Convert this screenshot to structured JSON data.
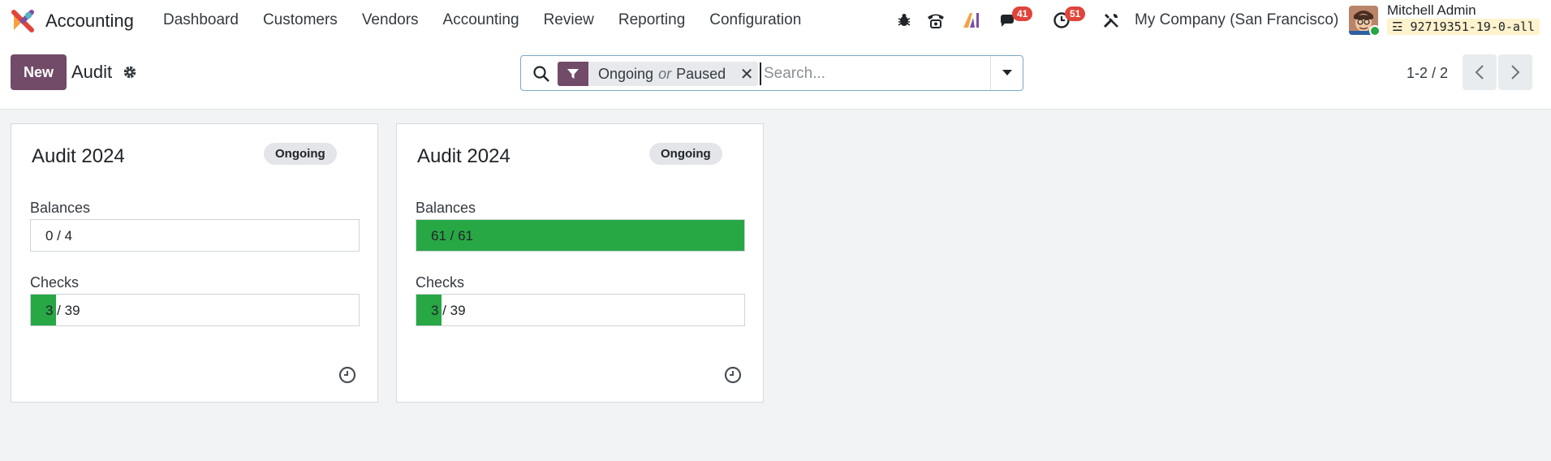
{
  "app": {
    "name": "Accounting"
  },
  "menu": [
    "Dashboard",
    "Customers",
    "Vendors",
    "Accounting",
    "Review",
    "Reporting",
    "Configuration"
  ],
  "systray": {
    "bug_icon": "bug-icon",
    "phone_icon": "phone-icon",
    "ai_icon": "ai-icon",
    "messages_count": "41",
    "activities_count": "51",
    "tools_icon": "tools-icon",
    "company": "My Company (San Francisco)",
    "user_name": "Mitchell Admin",
    "database": "92719351-19-0-all"
  },
  "control": {
    "new_label": "New",
    "title": "Audit",
    "facet_first": "Ongoing",
    "facet_or": "or",
    "facet_second": "Paused",
    "search_placeholder": "Search...",
    "pager": "1-2 / 2"
  },
  "cards": [
    {
      "title": "Audit 2024",
      "status": "Ongoing",
      "balances_label": "Balances",
      "balances_text": "0 / 4",
      "balances_value": 0,
      "balances_max": 4,
      "checks_label": "Checks",
      "checks_text": "3 / 39",
      "checks_value": 3,
      "checks_max": 39
    },
    {
      "title": "Audit 2024",
      "status": "Ongoing",
      "balances_label": "Balances",
      "balances_text": "61 / 61",
      "balances_value": 61,
      "balances_max": 61,
      "checks_label": "Checks",
      "checks_text": "3 / 39",
      "checks_value": 3,
      "checks_max": 39
    }
  ],
  "colors": {
    "brand": "#714b67",
    "progress": "#28a745",
    "badge": "#e0443a"
  }
}
